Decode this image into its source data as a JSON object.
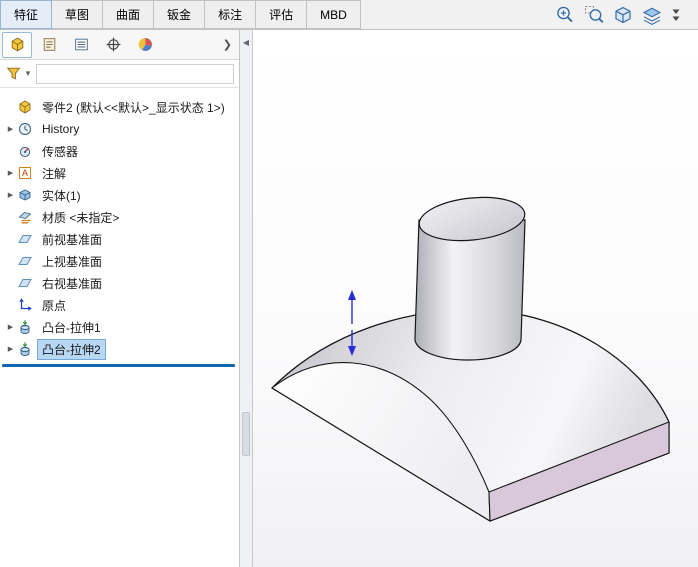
{
  "ribbon": {
    "tabs": [
      {
        "label": "特征",
        "active": true
      },
      {
        "label": "草图",
        "active": false
      },
      {
        "label": "曲面",
        "active": false
      },
      {
        "label": "钣金",
        "active": false
      },
      {
        "label": "标注",
        "active": false
      },
      {
        "label": "评估",
        "active": false
      },
      {
        "label": "MBD",
        "active": false
      }
    ]
  },
  "heads_up": {
    "icons": [
      {
        "name": "zoom-to-fit-icon",
        "glyph": "magnifier-plus"
      },
      {
        "name": "zoom-to-area-icon",
        "glyph": "magnifier-area"
      },
      {
        "name": "section-view-icon",
        "glyph": "cube-section"
      },
      {
        "name": "view-settings-icon",
        "glyph": "layers"
      }
    ],
    "overflow_icon": {
      "name": "toolbar-overflow-icon",
      "glyph": "double-chevron"
    }
  },
  "panel": {
    "tabs": [
      {
        "name": "featuremanager-tab",
        "icon": "part",
        "active": true
      },
      {
        "name": "propertymanager-tab",
        "icon": "property",
        "active": false
      },
      {
        "name": "configurationmanager-tab",
        "icon": "list",
        "active": false
      },
      {
        "name": "dimxpertmanager-tab",
        "icon": "crosshair",
        "active": false
      },
      {
        "name": "displaymanager-tab",
        "icon": "pie",
        "active": false
      }
    ],
    "tabs_overflow_glyph": "❯",
    "filter": {
      "value": "",
      "placeholder": ""
    },
    "root_label": "零件2 (默认<<默认>_显示状态 1>)",
    "items": [
      {
        "name": "history",
        "label": "History",
        "icon": "history",
        "expandable": true,
        "selected": false
      },
      {
        "name": "sensors",
        "label": "传感器",
        "icon": "sensor",
        "expandable": false,
        "selected": false
      },
      {
        "name": "annotations",
        "label": "注解",
        "icon": "annotation",
        "expandable": true,
        "selected": false
      },
      {
        "name": "solid-bodies",
        "label": "实体(1)",
        "icon": "solids",
        "expandable": true,
        "selected": false
      },
      {
        "name": "material",
        "label": "材质 <未指定>",
        "icon": "material",
        "expandable": false,
        "selected": false
      },
      {
        "name": "front-plane",
        "label": "前视基准面",
        "icon": "plane",
        "expandable": false,
        "selected": false
      },
      {
        "name": "top-plane",
        "label": "上视基准面",
        "icon": "plane",
        "expandable": false,
        "selected": false
      },
      {
        "name": "right-plane",
        "label": "右视基准面",
        "icon": "plane",
        "expandable": false,
        "selected": false
      },
      {
        "name": "origin",
        "label": "原点",
        "icon": "origin",
        "expandable": false,
        "selected": false
      },
      {
        "name": "boss-extrude1",
        "label": "凸台-拉伸1",
        "icon": "extrude",
        "expandable": true,
        "selected": false
      },
      {
        "name": "boss-extrude2",
        "label": "凸台-拉伸2",
        "icon": "extrude",
        "expandable": true,
        "selected": true
      }
    ]
  },
  "colors": {
    "selection_fill": "#b8d7f3",
    "selection_border": "#78a8d8",
    "rollback_bar": "#1267b2",
    "model_side_face": "#d9c8da",
    "origin_triad": "#2a2ad8",
    "edge": "#161616"
  }
}
